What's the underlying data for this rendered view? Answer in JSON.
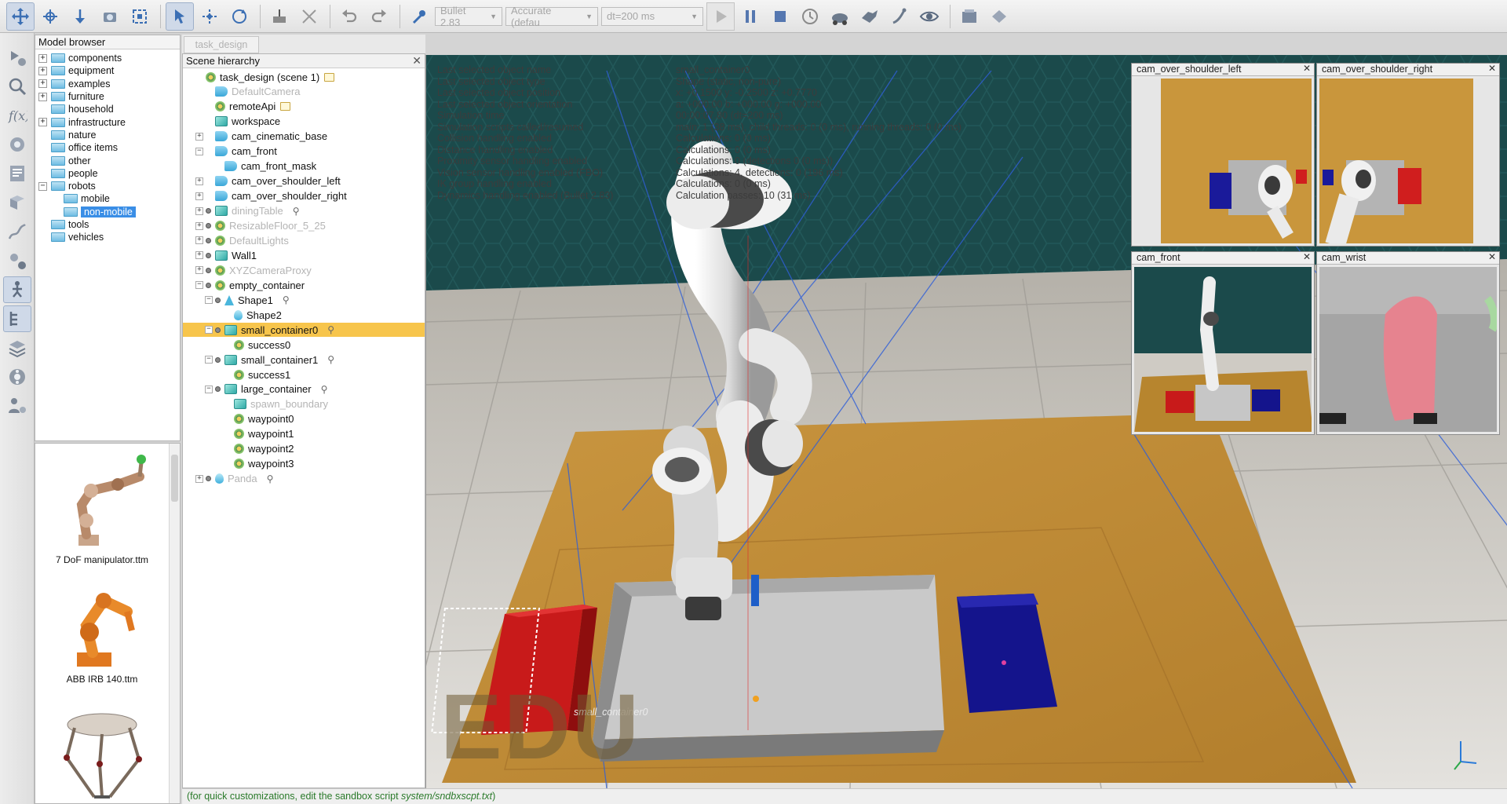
{
  "toolbar": {
    "engine": "Bullet 2.83",
    "accuracy": "Accurate (defau",
    "timestep": "dt=200 ms"
  },
  "model_browser": {
    "title": "Model browser",
    "items": [
      {
        "label": "components",
        "expander": "+"
      },
      {
        "label": "equipment",
        "expander": "+"
      },
      {
        "label": "examples",
        "expander": "+"
      },
      {
        "label": "furniture",
        "expander": "+"
      },
      {
        "label": "household",
        "expander": ""
      },
      {
        "label": "infrastructure",
        "expander": "+"
      },
      {
        "label": "nature",
        "expander": ""
      },
      {
        "label": "office items",
        "expander": ""
      },
      {
        "label": "other",
        "expander": ""
      },
      {
        "label": "people",
        "expander": ""
      },
      {
        "label": "robots",
        "expander": "−"
      },
      {
        "label": "mobile",
        "expander": ""
      },
      {
        "label": "non-mobile",
        "expander": ""
      },
      {
        "label": "tools",
        "expander": ""
      },
      {
        "label": "vehicles",
        "expander": ""
      }
    ],
    "thumbnails": [
      "7 DoF manipulator.ttm",
      "ABB IRB 140.ttm"
    ]
  },
  "scene_tab": "task_design",
  "scene_hierarchy": {
    "title": "Scene hierarchy",
    "rows": [
      {
        "label": "task_design (scene 1)"
      },
      {
        "label": "DefaultCamera"
      },
      {
        "label": "remoteApi"
      },
      {
        "label": "workspace"
      },
      {
        "label": "cam_cinematic_base"
      },
      {
        "label": "cam_front"
      },
      {
        "label": "cam_front_mask"
      },
      {
        "label": "cam_over_shoulder_left"
      },
      {
        "label": "cam_over_shoulder_right"
      },
      {
        "label": "diningTable"
      },
      {
        "label": "ResizableFloor_5_25"
      },
      {
        "label": "DefaultLights"
      },
      {
        "label": "Wall1"
      },
      {
        "label": "XYZCameraProxy"
      },
      {
        "label": "empty_container"
      },
      {
        "label": "Shape1"
      },
      {
        "label": "Shape2"
      },
      {
        "label": "small_container0"
      },
      {
        "label": "success0"
      },
      {
        "label": "small_container1"
      },
      {
        "label": "success1"
      },
      {
        "label": "large_container"
      },
      {
        "label": "spawn_boundary"
      },
      {
        "label": "waypoint0"
      },
      {
        "label": "waypoint1"
      },
      {
        "label": "waypoint2"
      },
      {
        "label": "waypoint3"
      },
      {
        "label": "Panda"
      }
    ]
  },
  "viewport": {
    "info_left": [
      "Last selected object name",
      "Last selected object type",
      "Last selected object position",
      "Last selected object orientation",
      "Simulation time",
      "Simulation scripts called/resumed",
      "Collision handling enabled",
      "Distance handling enabled",
      "Proximity sensor handling enabled",
      "Vision sensor handling enabled (FBO)",
      "IK group handling enabled",
      "Dynamics handling enabled (Bullet 2.83)"
    ],
    "info_right": [
      "small_container0",
      "Shape (static, non-pure)",
      "x: +0.1500   y: -0.2500   z: +0.7770",
      "a: +000.00   b: +000.00   g: +000.00",
      "00:00:07.80 (dt=200 ms)",
      "main: 1 (38 ms), child threads: 0 (0 ms), running threads: 0 (0 ms)",
      "Calculations: 0 (0 ms)",
      "Calculations: 0 (0 ms)",
      "Calculations: 0 (detections 0 (0 ms))",
      "Calculations: 4, detections: 0 (196 ms)",
      "Calculations: 0 (0 ms)",
      "Calculation passes: 10 (31 ms)"
    ],
    "object_tag": "small_container0",
    "watermark": "EDU"
  },
  "camera_views": [
    {
      "title": "cam_over_shoulder_left"
    },
    {
      "title": "cam_over_shoulder_right"
    },
    {
      "title": "cam_front"
    },
    {
      "title": "cam_wrist"
    }
  ],
  "status": {
    "prefix": "(for quick customizations, edit the sandbox script ",
    "path": "system/sndbxscpt.txt",
    "suffix": ")"
  },
  "colors": {
    "selection_highlight": "#f7c54c",
    "red_container": "#c81a1a",
    "blue_container": "#14148c",
    "table_wood": "#c28a36",
    "wall_teal": "#1b4a4b"
  }
}
